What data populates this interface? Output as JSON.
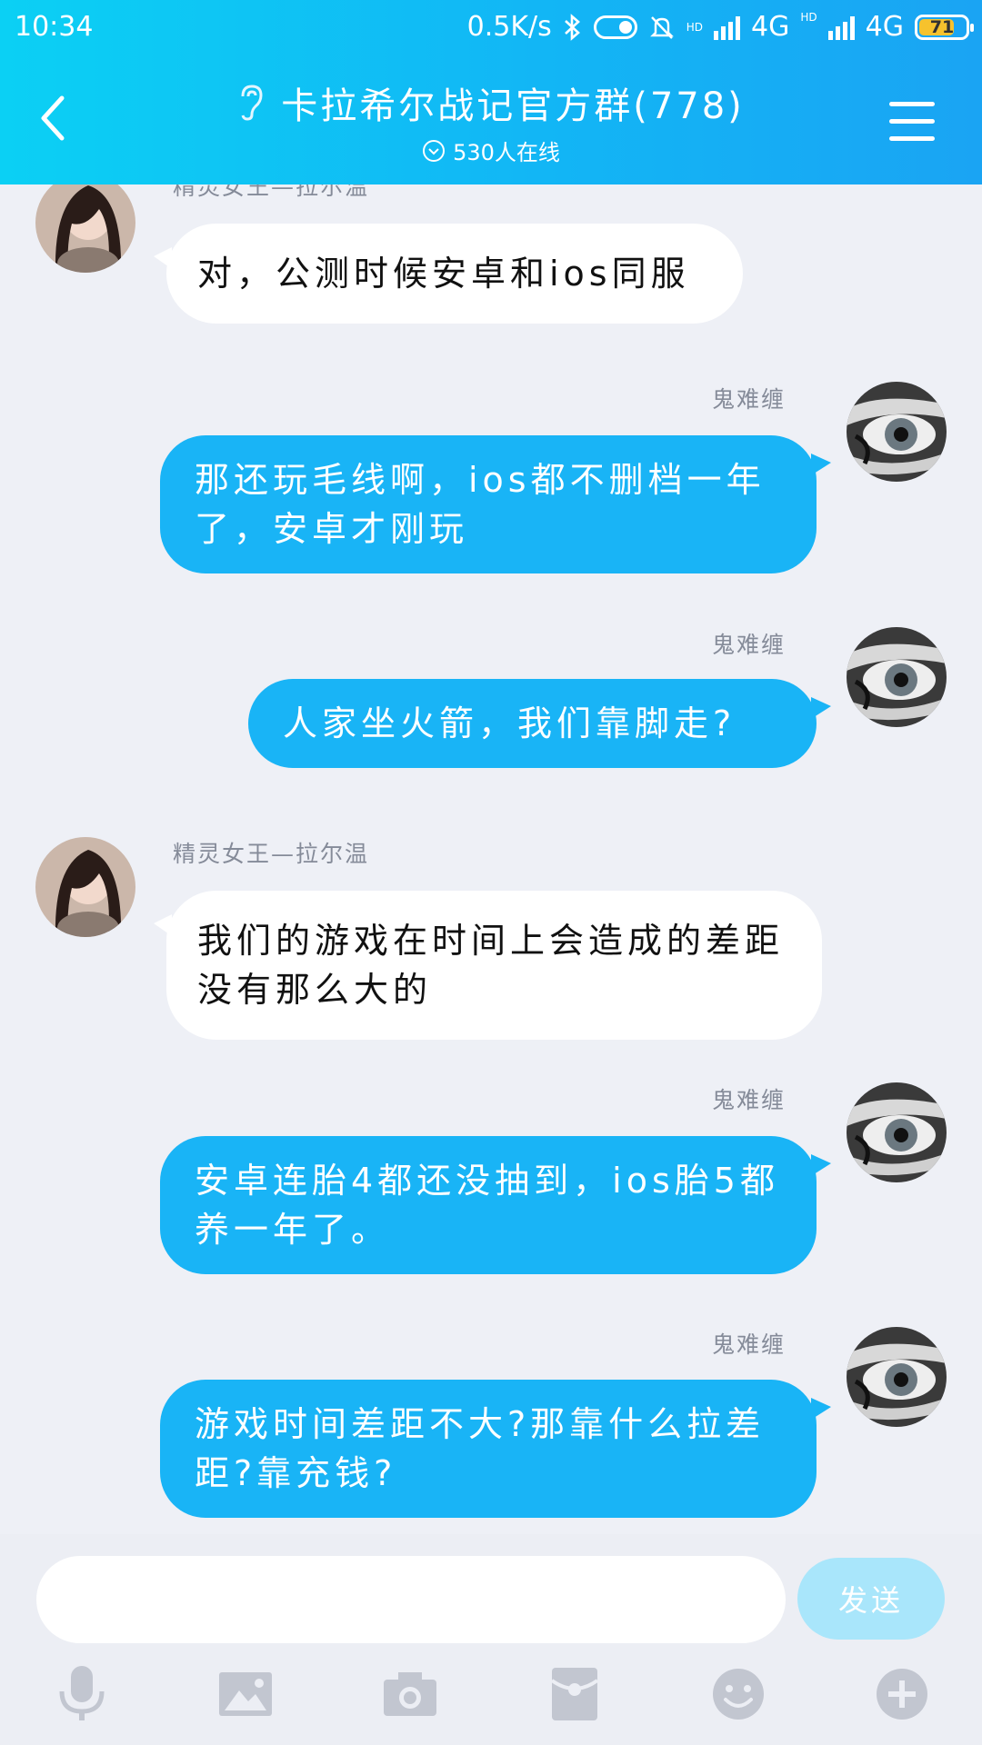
{
  "status_bar": {
    "time": "10:34",
    "speed": "0.5K/s",
    "network_1": "4G",
    "network_2": "4G",
    "hd_1": "HD",
    "hd_2": "HD",
    "battery": "71"
  },
  "header": {
    "title": "卡拉希尔战记官方群(778)",
    "online": "530人在线"
  },
  "messages": [
    {
      "sender": "精灵女王—拉尔温",
      "text": "对，公测时候安卓和ios同服",
      "direction": "in"
    },
    {
      "sender": "鬼难缠",
      "text": "那还玩毛线啊，ios都不删档一年了，安卓才刚玩",
      "direction": "out"
    },
    {
      "sender": "鬼难缠",
      "text": "人家坐火箭，我们靠脚走?",
      "direction": "out"
    },
    {
      "sender": "精灵女王—拉尔温",
      "text": "我们的游戏在时间上会造成的差距没有那么大的",
      "direction": "in"
    },
    {
      "sender": "鬼难缠",
      "text": "安卓连胎4都还没抽到，ios胎5都养一年了。",
      "direction": "out"
    },
    {
      "sender": "鬼难缠",
      "text": "游戏时间差距不大?那靠什么拉差距?靠充钱?",
      "direction": "out"
    }
  ],
  "input": {
    "value": "",
    "send_label": "发送"
  },
  "colors": {
    "header_start": "#0bd0f4",
    "header_end": "#1aa4f3",
    "outgoing_bubble": "#19b4f6",
    "incoming_bubble": "#ffffff",
    "chat_background": "#eef0f6"
  },
  "icons": {
    "toolbar": [
      "microphone-icon",
      "image-icon",
      "camera-icon",
      "red-packet-icon",
      "emoji-icon",
      "plus-icon"
    ]
  }
}
